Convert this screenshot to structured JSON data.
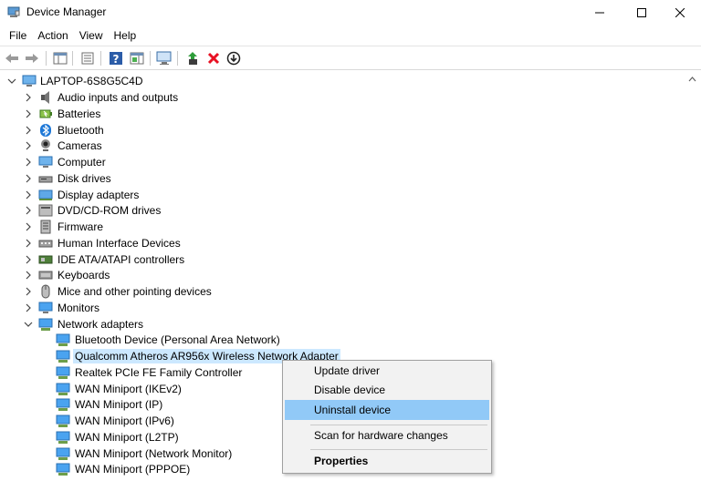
{
  "window": {
    "title": "Device Manager",
    "buttons": [
      "minimize",
      "maximize",
      "close"
    ]
  },
  "menubar": {
    "items": [
      "File",
      "Action",
      "View",
      "Help"
    ]
  },
  "toolbar": {
    "icons": [
      "back-arrow-icon",
      "forward-arrow-icon",
      "show-hide-console-tree-icon",
      "properties-icon",
      "help-icon",
      "action-pane-icon",
      "monitor-scan-icon",
      "update-driver-icon",
      "uninstall-x-icon",
      "download-driver-icon"
    ]
  },
  "tree": {
    "root": "LAPTOP-6S8G5C4D",
    "categories": [
      {
        "label": "Audio inputs and outputs",
        "icon": "speaker-icon"
      },
      {
        "label": "Batteries",
        "icon": "battery-icon"
      },
      {
        "label": "Bluetooth",
        "icon": "bluetooth-icon"
      },
      {
        "label": "Cameras",
        "icon": "camera-icon"
      },
      {
        "label": "Computer",
        "icon": "computer-icon"
      },
      {
        "label": "Disk drives",
        "icon": "disk-drive-icon"
      },
      {
        "label": "Display adapters",
        "icon": "display-adapter-icon"
      },
      {
        "label": "DVD/CD-ROM drives",
        "icon": "dvd-drive-icon"
      },
      {
        "label": "Firmware",
        "icon": "firmware-icon"
      },
      {
        "label": "Human Interface Devices",
        "icon": "hid-icon"
      },
      {
        "label": "IDE ATA/ATAPI controllers",
        "icon": "ide-controller-icon"
      },
      {
        "label": "Keyboards",
        "icon": "keyboard-icon"
      },
      {
        "label": "Mice and other pointing devices",
        "icon": "mouse-icon"
      },
      {
        "label": "Monitors",
        "icon": "monitor-icon"
      },
      {
        "label": "Network adapters",
        "icon": "network-adapter-icon"
      }
    ],
    "network_children": [
      "Bluetooth Device (Personal Area Network)",
      "Qualcomm Atheros AR956x Wireless Network Adapter",
      "Realtek PCIe FE Family Controller",
      "WAN Miniport (IKEv2)",
      "WAN Miniport (IP)",
      "WAN Miniport (IPv6)",
      "WAN Miniport (L2TP)",
      "WAN Miniport (Network Monitor)",
      "WAN Miniport (PPPOE)"
    ],
    "selected_child": "Qualcomm Atheros AR956x Wireless Network Adapter"
  },
  "context_menu": {
    "items": [
      "Update driver",
      "Disable device",
      "Uninstall device",
      "Scan for hardware changes",
      "Properties"
    ],
    "highlighted": "Uninstall device",
    "default": "Properties"
  },
  "colors": {
    "selection": "#cce8ff",
    "menu_highlight": "#91c9f7",
    "menu_background": "#f2f2f2",
    "uninstall_red": "#e81123",
    "icon_blue": "#1e78d7"
  }
}
